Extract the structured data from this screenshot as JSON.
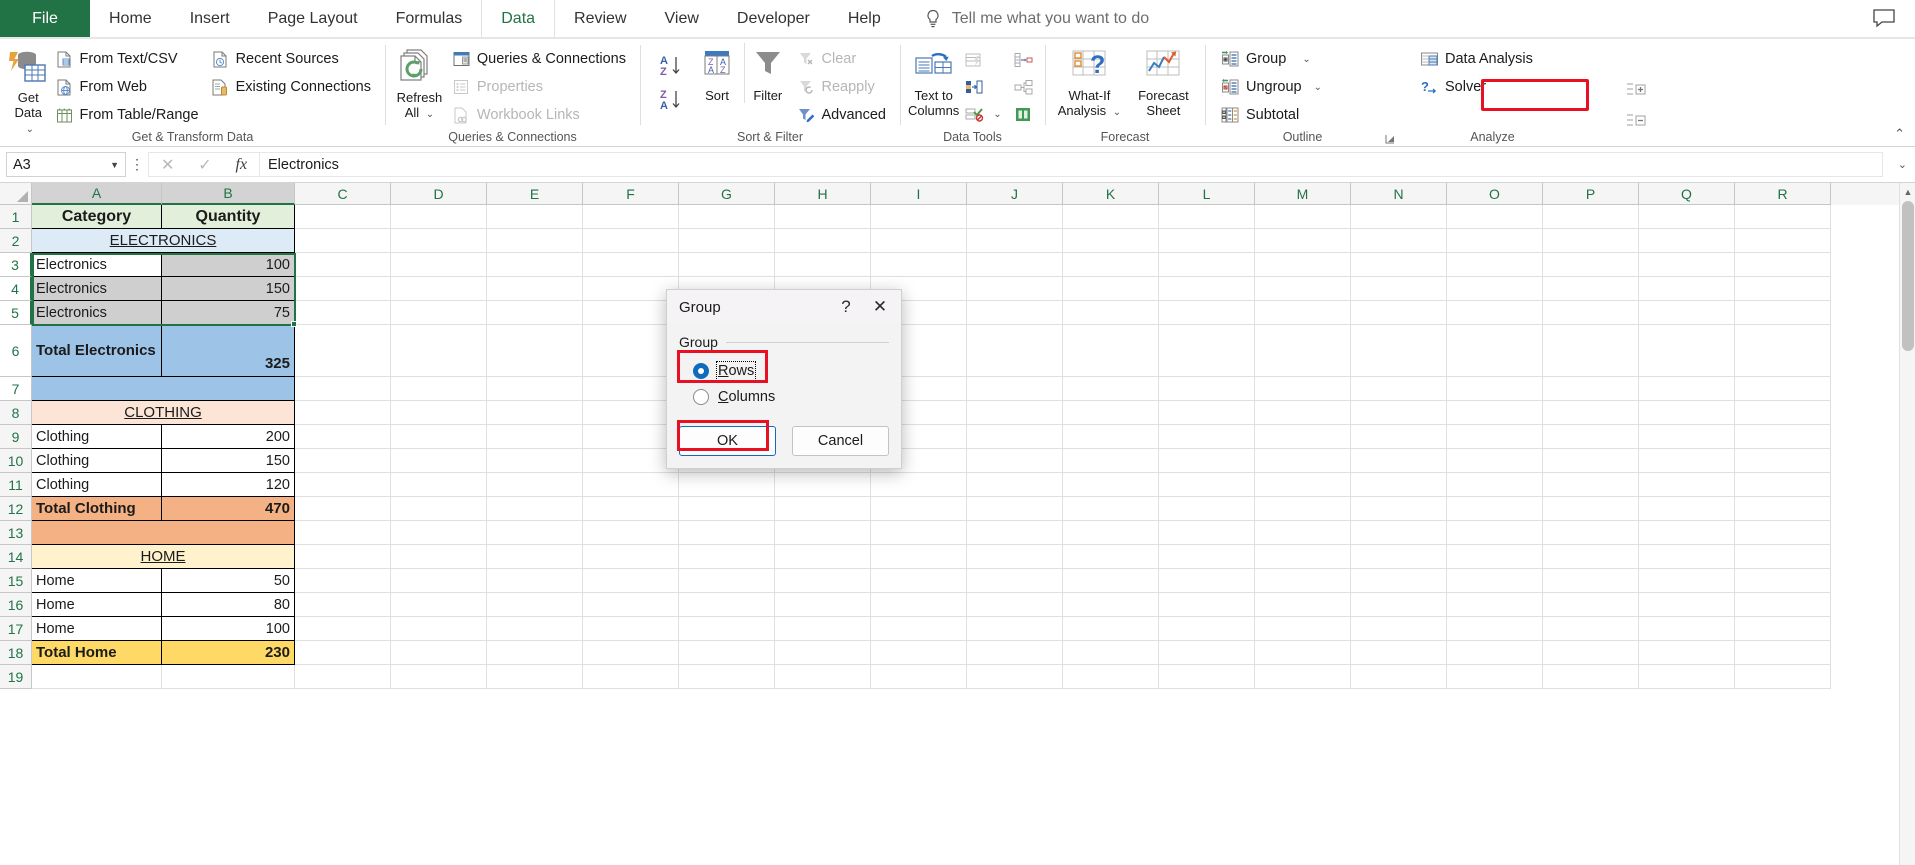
{
  "tabs": [
    {
      "label": "File",
      "active": false,
      "file": true
    },
    {
      "label": "Home",
      "active": false
    },
    {
      "label": "Insert",
      "active": false
    },
    {
      "label": "Page Layout",
      "active": false
    },
    {
      "label": "Formulas",
      "active": false
    },
    {
      "label": "Data",
      "active": true
    },
    {
      "label": "Review",
      "active": false
    },
    {
      "label": "View",
      "active": false
    },
    {
      "label": "Developer",
      "active": false
    },
    {
      "label": "Help",
      "active": false
    }
  ],
  "tellme": {
    "placeholder": "Tell me what you want to do",
    "icon": "lightbulb-icon"
  },
  "ribbon": {
    "groups": [
      {
        "label": "Get & Transform Data",
        "big": {
          "label": "Get\nData",
          "icon": "get-data-icon",
          "dropdown": true
        },
        "items": [
          {
            "label": "From Text/CSV",
            "icon": "text-csv-icon",
            "disabled": false
          },
          {
            "label": "From Web",
            "icon": "from-web-icon",
            "disabled": false
          },
          {
            "label": "From Table/Range",
            "icon": "from-table-icon",
            "disabled": false
          },
          {
            "label": "Recent Sources",
            "icon": "recent-sources-icon",
            "disabled": false
          },
          {
            "label": "Existing Connections",
            "icon": "existing-connections-icon",
            "disabled": false
          }
        ]
      },
      {
        "label": "Queries & Connections",
        "big": {
          "label": "Refresh\nAll",
          "icon": "refresh-all-icon",
          "dropdown": true
        },
        "items": [
          {
            "label": "Queries & Connections",
            "icon": "queries-connections-icon",
            "disabled": false
          },
          {
            "label": "Properties",
            "icon": "properties-icon",
            "disabled": true
          },
          {
            "label": "Workbook Links",
            "icon": "workbook-links-icon",
            "disabled": true
          }
        ]
      },
      {
        "label": "Sort & Filter",
        "sortasc": "sort-ascending-icon",
        "sortdesc": "sort-descending-icon",
        "big": [
          {
            "label": "Sort",
            "icon": "sort-icon"
          },
          {
            "label": "Filter",
            "icon": "filter-icon"
          }
        ],
        "items": [
          {
            "label": "Clear",
            "icon": "clear-filter-icon",
            "disabled": true
          },
          {
            "label": "Reapply",
            "icon": "reapply-filter-icon",
            "disabled": true
          },
          {
            "label": "Advanced",
            "icon": "advanced-filter-icon",
            "disabled": false
          }
        ]
      },
      {
        "label": "Data Tools",
        "big": {
          "label": "Text to\nColumns",
          "icon": "text-to-columns-icon"
        },
        "icons": [
          "flash-fill-icon",
          "remove-duplicates-icon",
          "data-validation-icon",
          "consolidate-icon",
          "relationships-icon",
          "manage-data-model-icon"
        ]
      },
      {
        "label": "Forecast",
        "big": [
          {
            "label": "What-If\nAnalysis",
            "icon": "what-if-analysis-icon",
            "dropdown": true
          },
          {
            "label": "Forecast\nSheet",
            "icon": "forecast-sheet-icon"
          }
        ]
      },
      {
        "label": "Outline",
        "items": [
          {
            "label": "Group",
            "icon": "group-icon",
            "dropdown": true,
            "highlighted": true
          },
          {
            "label": "Ungroup",
            "icon": "ungroup-icon",
            "dropdown": true
          },
          {
            "label": "Subtotal",
            "icon": "subtotal-icon"
          }
        ],
        "side_icons": [
          "show-detail-icon",
          "hide-detail-icon"
        ],
        "dialog_launcher": "outline-settings-launcher"
      },
      {
        "label": "Analyze",
        "items": [
          {
            "label": "Data Analysis",
            "icon": "data-analysis-icon"
          },
          {
            "label": "Solver",
            "icon": "solver-icon"
          }
        ]
      }
    ],
    "collapse_icon": "collapse-ribbon-icon"
  },
  "formula_bar": {
    "name_box_value": "A3",
    "cancel_icon": "cancel-entry-icon",
    "enter_icon": "confirm-entry-icon",
    "fx_icon": "insert-function-icon",
    "formula_value": "Electronics",
    "expand_icon": "expand-formula-bar-icon"
  },
  "grid": {
    "columns": [
      "A",
      "B",
      "C",
      "D",
      "E",
      "F",
      "G",
      "H",
      "I",
      "J",
      "K",
      "L",
      "M",
      "N",
      "O",
      "P",
      "Q",
      "R"
    ],
    "selected_columns": [
      "A",
      "B"
    ],
    "row_numbers": [
      "1",
      "2",
      "3",
      "4",
      "5",
      "6",
      "7",
      "8",
      "9",
      "10",
      "11",
      "12",
      "13",
      "14",
      "15",
      "16",
      "17",
      "18",
      "19"
    ],
    "selected_rows": [
      "3",
      "4",
      "5"
    ],
    "selection_range": "A3:B5",
    "active_cell": "A3",
    "rows": [
      {
        "n": "1",
        "a": "Category",
        "b": "Quantity",
        "style": "header"
      },
      {
        "n": "2",
        "a": "ELECTRONICS",
        "b": "",
        "style": "section-electronics",
        "merged": true
      },
      {
        "n": "3",
        "a": "Electronics",
        "b": "100",
        "style": "data",
        "selected": true,
        "active": true
      },
      {
        "n": "4",
        "a": "Electronics",
        "b": "150",
        "style": "data",
        "selected": true
      },
      {
        "n": "5",
        "a": "Electronics",
        "b": "75",
        "style": "data",
        "selected": true
      },
      {
        "n": "6",
        "a": "Total Electronics",
        "b": "325",
        "style": "total-electronics",
        "tall": true
      },
      {
        "n": "7",
        "a": "",
        "b": "",
        "style": "total-electronics"
      },
      {
        "n": "8",
        "a": "CLOTHING",
        "b": "",
        "style": "section-clothing",
        "merged": true
      },
      {
        "n": "9",
        "a": "Clothing",
        "b": "200",
        "style": "plain"
      },
      {
        "n": "10",
        "a": "Clothing",
        "b": "150",
        "style": "plain"
      },
      {
        "n": "11",
        "a": "Clothing",
        "b": "120",
        "style": "plain"
      },
      {
        "n": "12",
        "a": "Total Clothing",
        "b": "470",
        "style": "total-clothing"
      },
      {
        "n": "13",
        "a": "",
        "b": "",
        "style": "total-clothing"
      },
      {
        "n": "14",
        "a": "HOME",
        "b": "",
        "style": "section-home",
        "merged": true
      },
      {
        "n": "15",
        "a": "Home",
        "b": "50",
        "style": "plain"
      },
      {
        "n": "16",
        "a": "Home",
        "b": "80",
        "style": "plain"
      },
      {
        "n": "17",
        "a": "Home",
        "b": "100",
        "style": "plain"
      },
      {
        "n": "18",
        "a": "Total Home",
        "b": "230",
        "style": "total-home"
      },
      {
        "n": "19",
        "a": "",
        "b": "",
        "style": "empty"
      }
    ]
  },
  "dialog": {
    "title": "Group",
    "help_label": "?",
    "close_label": "✕",
    "fieldset_label": "Group",
    "options": [
      {
        "label": "Rows",
        "accel": "R",
        "selected": true,
        "highlighted": true
      },
      {
        "label": "Columns",
        "accel": "C",
        "selected": false,
        "highlighted": false
      }
    ],
    "ok_label": "OK",
    "cancel_label": "Cancel"
  },
  "colors": {
    "accent_green": "#217346",
    "highlight_red": "#e81123",
    "header_fill": "#e2efda",
    "electronics_section": "#ddebf7",
    "electronics_total": "#9dc3e6",
    "clothing_section": "#fce4d6",
    "clothing_total": "#f4b183",
    "home_section": "#fff2cc",
    "home_total": "#ffd966",
    "selection_fill": "#cfcfcf",
    "radio_blue": "#0f6cbd"
  }
}
